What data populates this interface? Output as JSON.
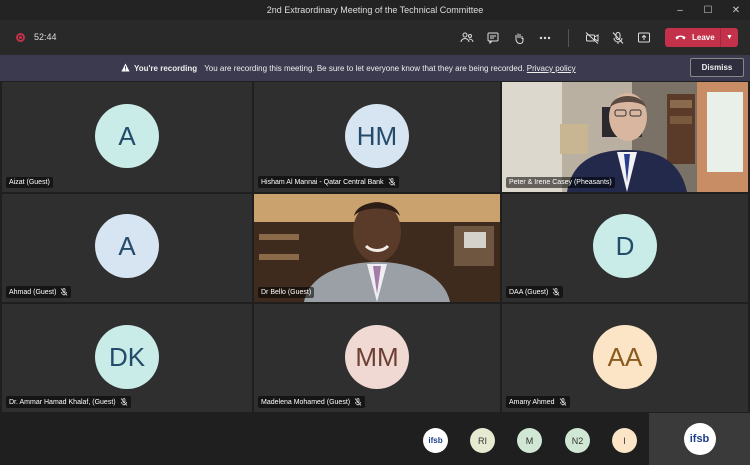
{
  "window": {
    "title": "2nd Extraordinary Meeting of the Technical Committee",
    "controls": [
      "–",
      "☐",
      "✕"
    ]
  },
  "toolbar": {
    "timer": "52:44",
    "leave_label": "Leave"
  },
  "banner": {
    "bold": "You're recording",
    "message": "You are recording this meeting. Be sure to let everyone know that they are being recorded.",
    "link": "Privacy policy",
    "dismiss": "Dismiss"
  },
  "tiles": [
    {
      "name": "Aizat (Guest)",
      "initials": "A",
      "color": "#c9ece8",
      "muted": false
    },
    {
      "name": "Hisham Al Mannai - Qatar Central Bank",
      "initials": "HM",
      "color": "#d7e4f2",
      "muted": true
    },
    {
      "name": "Peter & Irene Casey (Pheasants)",
      "initials": "",
      "video": true,
      "muted": false
    },
    {
      "name": "Ahmad (Guest)",
      "initials": "A",
      "color": "#d7e4f2",
      "muted": true
    },
    {
      "name": "Dr Bello (Guest)",
      "initials": "",
      "video": true,
      "muted": false
    },
    {
      "name": "DAA (Guest)",
      "initials": "D",
      "color": "#c9ece8",
      "muted": true
    },
    {
      "name": "Dr. Ammar Hamad Khalaf, (Guest)",
      "initials": "DK",
      "color": "#c9ece8",
      "muted": true
    },
    {
      "name": "Madelena Mohamed (Guest)",
      "initials": "MM",
      "color": "#efd9d2",
      "muted": true
    },
    {
      "name": "Amany Ahmed",
      "initials": "AA",
      "color": "#fbe5c6",
      "muted": true
    }
  ],
  "overflow": [
    {
      "label": "ifsb",
      "color": "#ffffff"
    },
    {
      "label": "RI",
      "color": "#e6ead0"
    },
    {
      "label": "M",
      "color": "#cfe7d4"
    },
    {
      "label": "N2",
      "color": "#cfe7d4"
    },
    {
      "label": "I",
      "color": "#fbe5c6"
    }
  ],
  "self_view": {
    "label": "ifsb"
  }
}
